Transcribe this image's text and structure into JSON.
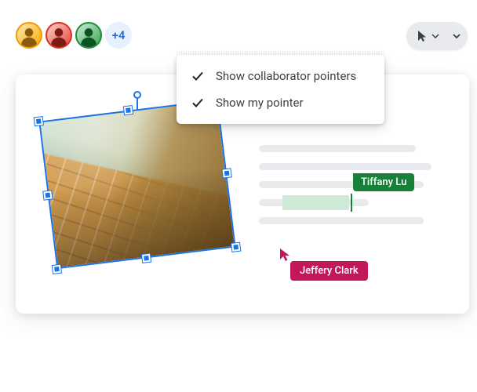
{
  "avatars_more": "+4",
  "dropdown": {
    "items": [
      {
        "label": "Show collaborator pointers",
        "checked": true
      },
      {
        "label": "Show my pointer",
        "checked": true
      }
    ]
  },
  "collaborators": {
    "tiffany": "Tiffany Lu",
    "jeffery": "Jeffery Clark"
  },
  "colors": {
    "tiffany": "#188038",
    "jeffery": "#c2185b",
    "selection": "#1a73e8"
  }
}
